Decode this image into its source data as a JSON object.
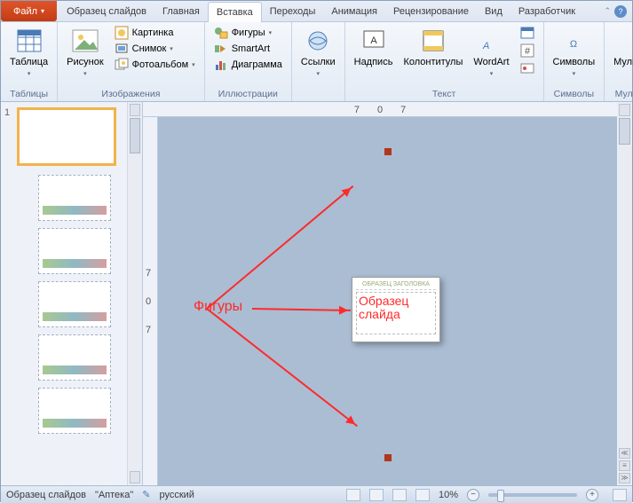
{
  "tabs": {
    "file": "Файл",
    "items": [
      "Образец слайдов",
      "Главная",
      "Вставка",
      "Переходы",
      "Анимация",
      "Рецензирование",
      "Вид",
      "Разработчик"
    ],
    "active_index": 2
  },
  "ribbon": {
    "groups": {
      "tables": {
        "label": "Таблицы",
        "table_btn": "Таблица"
      },
      "images": {
        "label": "Изображения",
        "picture_btn": "Рисунок",
        "clipart": "Картинка",
        "screenshot": "Снимок",
        "album": "Фотоальбом"
      },
      "illustrations": {
        "label": "Иллюстрации",
        "shapes": "Фигуры",
        "smartart": "SmartArt",
        "chart": "Диаграмма"
      },
      "links": {
        "label": "",
        "links_btn": "Ссылки"
      },
      "text": {
        "label": "Текст",
        "textbox": "Надпись",
        "headerfooter": "Колонтитулы",
        "wordart": "WordArt"
      },
      "symbols": {
        "label": "Символы",
        "btn": "Символы"
      },
      "media": {
        "label": "Мультимедиа",
        "btn": "Мультимедиа"
      }
    }
  },
  "ruler": {
    "h": [
      "7",
      "0",
      "7"
    ],
    "v": [
      "7",
      "0",
      "7"
    ]
  },
  "thumbs": {
    "master_num": "1"
  },
  "annotations": {
    "shapes_label": "Фигуры",
    "sample_header": "ОБРАЗЕЦ ЗАГОЛОВКА",
    "sample_body": "Образец слайда"
  },
  "status": {
    "mode": "Образец слайдов",
    "theme": "\"Аптека\"",
    "lang": "русский",
    "zoom": "10%"
  }
}
